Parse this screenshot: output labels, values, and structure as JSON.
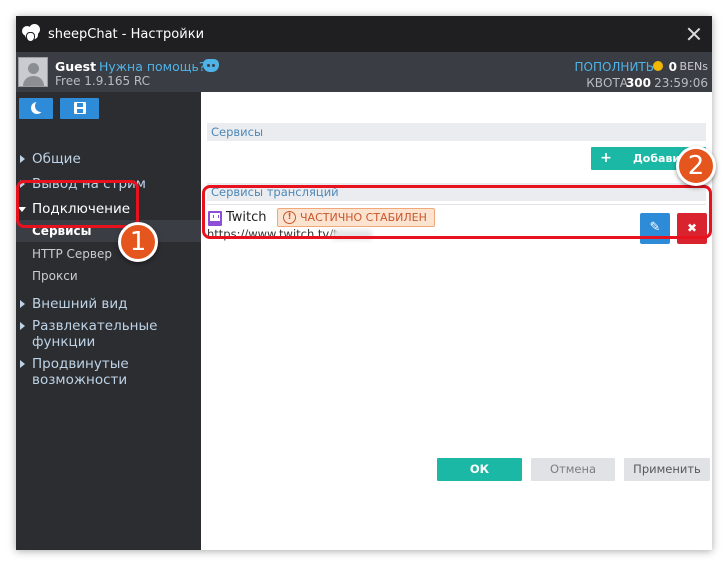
{
  "window": {
    "title": "sheepChat - Настройки",
    "icon": "sheep-icon"
  },
  "user": {
    "name": "Guest",
    "help_link": "Нужна помощь?",
    "version": "Free 1.9.165 RC",
    "topup_label": "ПОПОЛНИТЬ",
    "ben_amount": "0",
    "ben_unit": "BENs",
    "quota_label": "КВОТА",
    "quota_value": "300",
    "quota_time": "23:59:06"
  },
  "sidebar": {
    "items": [
      {
        "label": "Общие"
      },
      {
        "label": "Вывод на стрим"
      },
      {
        "label": "Подключение"
      },
      {
        "label": "Сервисы"
      },
      {
        "label": "HTTP Сервер"
      },
      {
        "label": "Прокси"
      },
      {
        "label": "Внешний вид"
      },
      {
        "label": "Развлекательные функции"
      },
      {
        "label": "Продвинутые возможности"
      }
    ],
    "active": "Сервисы"
  },
  "main": {
    "services_header": "Сервисы",
    "add_button": "Добавить",
    "stream_services_header": "Сервисы трансляций",
    "services": [
      {
        "name": "Twitch",
        "status": "ЧАСТИЧНО СТАБИЛЕН",
        "url": "https://www.twitch.tv/t"
      }
    ]
  },
  "footer": {
    "ok": "ОК",
    "cancel": "Отмена",
    "apply": "Применить"
  },
  "annotations": {
    "badge_1": "1",
    "badge_2": "2"
  },
  "colors": {
    "accent_blue": "#2e8bd8",
    "teal": "#1bb8a5",
    "danger": "#d9242f",
    "highlight": "#e8121e",
    "badge": "#e4561d",
    "link": "#4fb3e8"
  }
}
